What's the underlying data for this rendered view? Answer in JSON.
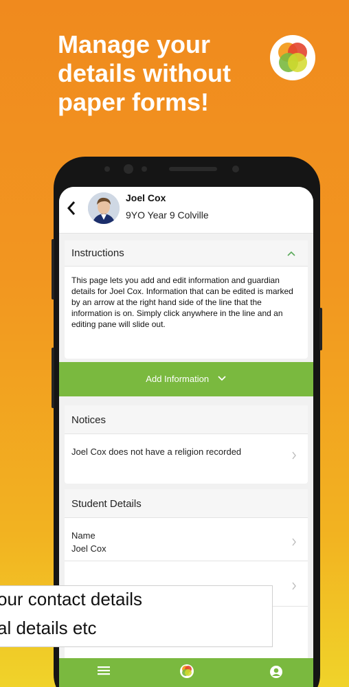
{
  "headline": {
    "line1": "Manage your",
    "line2": "details without",
    "line3": "paper forms!"
  },
  "profile": {
    "name": "Joel Cox",
    "subtitle": "9YO  Year 9  Colville"
  },
  "instructions": {
    "title": "Instructions",
    "text": "This page lets you add and edit information and guardian details for Joel Cox. Information that can be edited is marked by an arrow at the right hand side of the line that the information is on. Simply click anywhere in the line and an editing pane will slide out."
  },
  "add_button": {
    "label": "Add Information"
  },
  "notices": {
    "title": "Notices",
    "item": "Joel Cox does not have a religion recorded"
  },
  "student_details": {
    "title": "Student Details",
    "name_label": "Name",
    "name_value": "Joel Cox"
  },
  "overlay": {
    "line1": "our contact details",
    "line2": "al details etc"
  },
  "icons": {
    "back": "chevron-left-icon",
    "collapse": "chevron-up-icon",
    "expand": "chevron-down-icon",
    "row": "chevron-right-icon",
    "menu": "hamburger-icon",
    "home": "app-logo-icon",
    "profile": "user-circle-icon"
  },
  "colors": {
    "brand_green": "#7ab93f",
    "bg_orange": "#f29620",
    "bg_yellow": "#f0d32a"
  }
}
